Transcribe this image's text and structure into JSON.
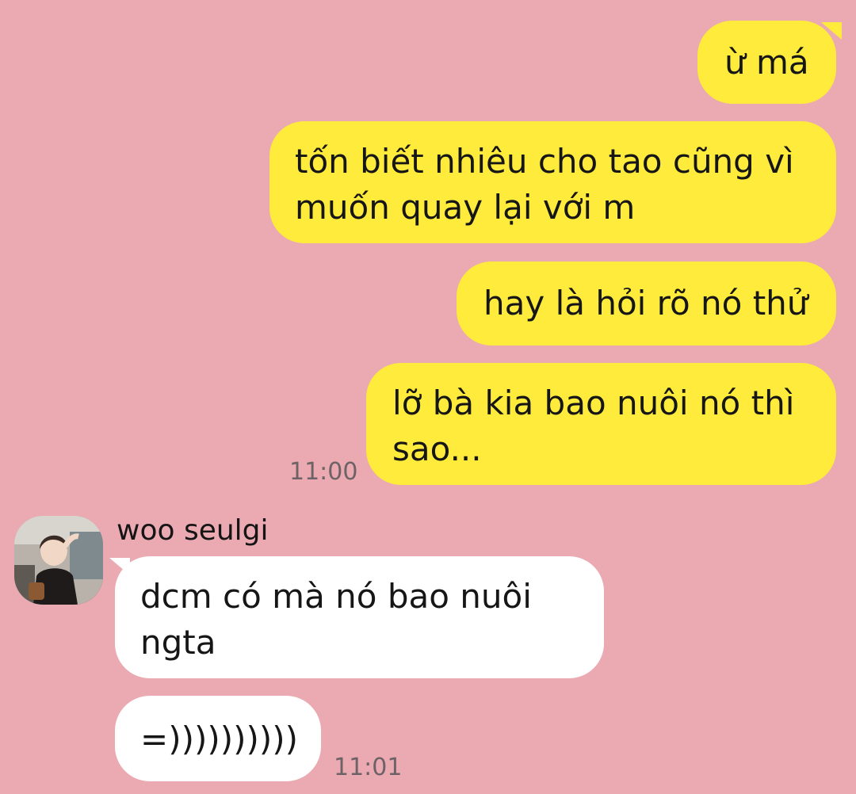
{
  "conversation": {
    "sent_messages": [
      {
        "text": "ừ má"
      },
      {
        "text": "tốn biết nhiêu cho tao cũng vì\nmuốn quay lại với m"
      },
      {
        "text": "hay là hỏi rõ nó thử"
      },
      {
        "text": "lỡ bà kia bao nuôi nó thì\nsao..."
      }
    ],
    "sent_time": "11:00",
    "contact": {
      "name": "woo seulgi",
      "avatar_icon": "profile-photo"
    },
    "received_messages": [
      {
        "text": "dcm có mà nó bao nuôi\nngta"
      },
      {
        "text": "=))))))))))"
      }
    ],
    "received_time": "11:01"
  },
  "colors": {
    "background": "#eba9b2",
    "sent_bubble": "#ffeb3b",
    "received_bubble": "#ffffff",
    "timestamp": "#6d6366"
  }
}
